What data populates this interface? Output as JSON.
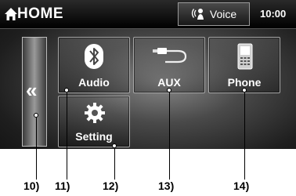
{
  "header": {
    "title": "HOME",
    "voice_label": "Voice",
    "clock": "10:00"
  },
  "back_tile": {
    "glyph": "«"
  },
  "tiles": [
    {
      "label": "Audio",
      "icon": "bluetooth-icon"
    },
    {
      "label": "AUX",
      "icon": "aux-cable-icon"
    },
    {
      "label": "Phone",
      "icon": "phone-icon"
    },
    {
      "label": "Setting",
      "icon": "gear-icon"
    }
  ],
  "callouts": [
    "10)",
    "11)",
    "12)",
    "13)",
    "14)"
  ]
}
